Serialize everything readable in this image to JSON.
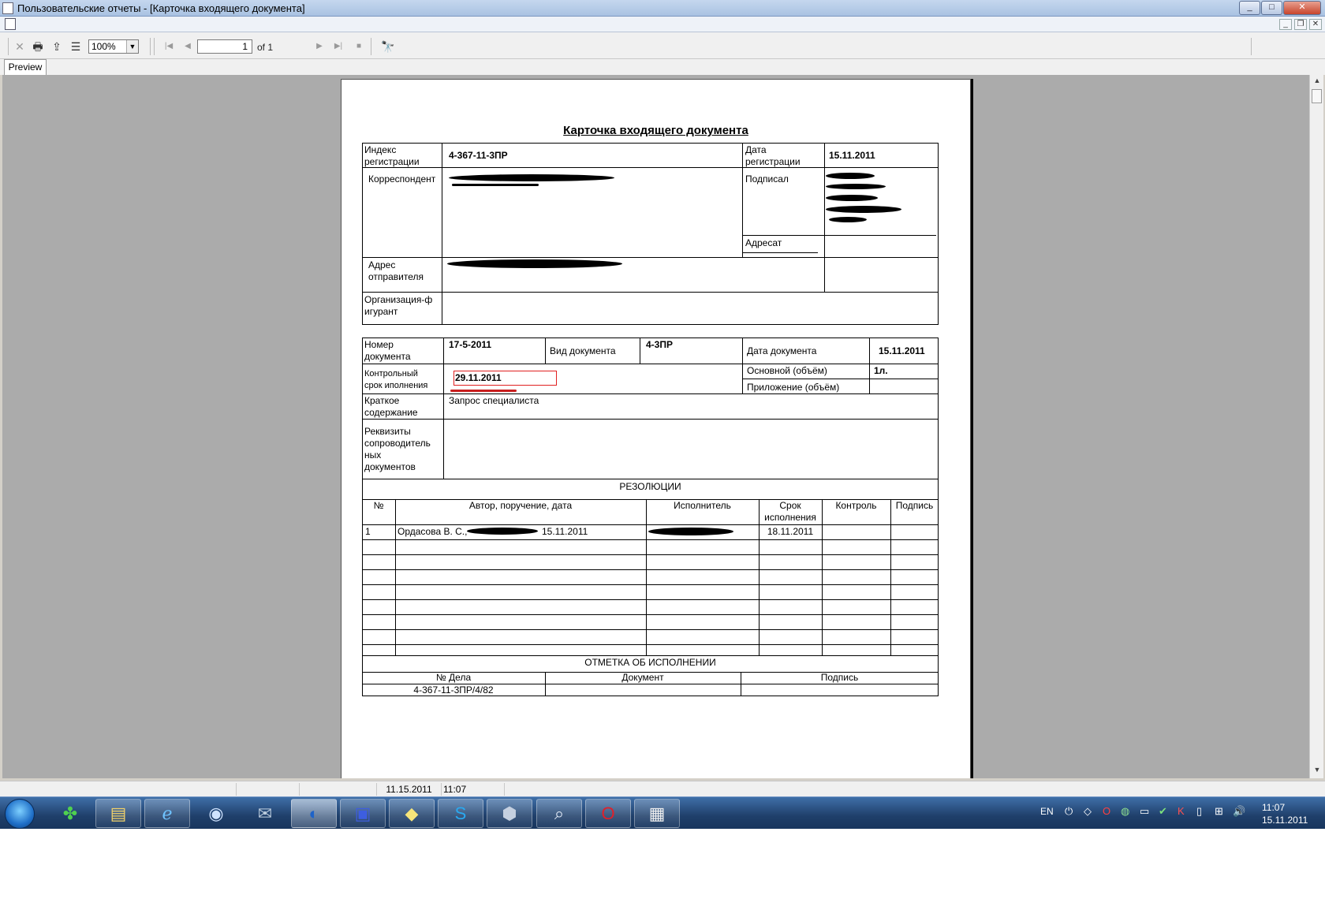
{
  "window": {
    "title": "Пользовательские отчеты - [Карточка входящего документа]",
    "controls": {
      "minimize": "_",
      "maximize": "□",
      "close": "✕"
    }
  },
  "mdi": {
    "minimize": "_",
    "restore": "❐",
    "close": "✕"
  },
  "toolbar": {
    "zoom": "100%",
    "page_number": "1",
    "page_of": "of 1",
    "icons": {
      "close": "✕",
      "print": "🖶",
      "export": "⇪",
      "tree": "☰",
      "first": "|◀",
      "prev": "◀",
      "next": "▶",
      "last": "▶|",
      "stop": "■",
      "find": "🔭"
    }
  },
  "tabs": {
    "preview": "Preview"
  },
  "doc": {
    "title": "Карточка входящего документа",
    "reg_index_label": "Индекс регистрации",
    "reg_index_label_l1": "Индекс",
    "reg_index_label_l2": "регистрации",
    "reg_index_value": "4-367-11-3ПР",
    "reg_date_label_l1": "Дата",
    "reg_date_label_l2": "регистрации",
    "reg_date_value": "15.11.2011",
    "correspondent_label": "Корреспондент",
    "signed_label": "Подписал",
    "addressee_label": "Адресат",
    "sender_addr_label_l1": "Адрес",
    "sender_addr_label_l2": "отправителя",
    "org_label_l1": "Организация-ф",
    "org_label_l2": "игурант",
    "doc_num_label_l1": "Номер",
    "doc_num_label_l2": "документа",
    "doc_num_value": "17-5-2011",
    "doc_type_label": "Вид документа",
    "doc_type_value": "4-3ПР",
    "doc_date_label": "Дата документа",
    "doc_date_value": "15.11.2011",
    "control_label_l1": "Контрольный",
    "control_label_l2": "срок иполнения",
    "control_value": "29.11.2011",
    "volume_label": "Основной (объём)",
    "volume_value": "1л.",
    "appendix_label": "Приложение (объём)",
    "summary_label_l1": "Краткое",
    "summary_label_l2": "содержание",
    "summary_value": "Запрос специалиста",
    "requisites_label_l1": "Реквизиты",
    "requisites_label_l2": "сопроводитель",
    "requisites_label_l3": "ных",
    "requisites_label_l4": "документов",
    "resolutions_header": "РЕЗОЛЮЦИИ",
    "res_columns": {
      "num": "№",
      "author": "Автор, поручение, дата",
      "executor": "Исполнитель",
      "deadline_l1": "Срок",
      "deadline_l2": "исполнения",
      "control": "Контроль",
      "signature": "Подпись"
    },
    "res_row1": {
      "num": "1",
      "author": "Ордасова В. С.,",
      "date": "15.11.2011",
      "deadline": "18.11.2011"
    },
    "execution_header": "ОТМЕТКА ОБ ИСПОЛНЕНИИ",
    "exec_columns": {
      "case": "№ Дела",
      "document": "Документ",
      "signature": "Подпись"
    },
    "exec_case_value": "4-367-11-3ПР/4/82"
  },
  "status": {
    "date": "11.15.2011",
    "time": "11:07"
  },
  "taskbar": {
    "lang": "EN",
    "clock_time": "11:07",
    "clock_date": "15.11.2011",
    "apps": [
      "start-orb",
      "clover",
      "explorer",
      "ie",
      "globe",
      "thunderbird",
      "report-app",
      "save",
      "sticky",
      "skype",
      "virtualbox",
      "search",
      "opera",
      "notes"
    ]
  },
  "colors": {
    "red_box": "#e02020",
    "red_underline": "#c81e1e",
    "preview_bg": "#ababab"
  }
}
